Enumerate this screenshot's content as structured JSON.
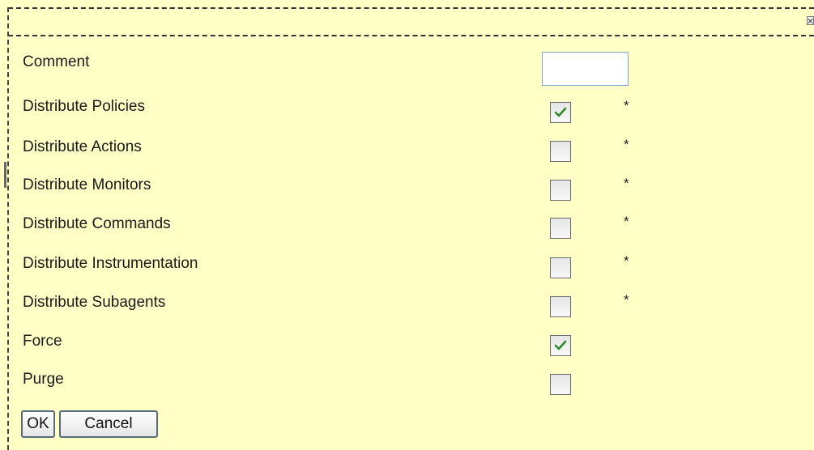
{
  "dialog": {
    "close_icon": "close-icon"
  },
  "fields": [
    {
      "label": "Comment",
      "type": "text",
      "value": ""
    },
    {
      "label": "Distribute Policies",
      "type": "checkbox",
      "checked": true,
      "asterisk": "*"
    },
    {
      "label": "Distribute Actions",
      "type": "checkbox",
      "checked": false,
      "asterisk": "*"
    },
    {
      "label": "Distribute Monitors",
      "type": "checkbox",
      "checked": false,
      "asterisk": "*"
    },
    {
      "label": "Distribute Commands",
      "type": "checkbox",
      "checked": false,
      "asterisk": "*"
    },
    {
      "label": "Distribute Instrumentation",
      "type": "checkbox",
      "checked": false,
      "asterisk": "*"
    },
    {
      "label": "Distribute Subagents",
      "type": "checkbox",
      "checked": false,
      "asterisk": "*"
    },
    {
      "label": "Force",
      "type": "checkbox",
      "checked": true
    },
    {
      "label": "Purge",
      "type": "checkbox",
      "checked": false
    }
  ],
  "buttons": {
    "ok_label": "OK",
    "cancel_label": "Cancel"
  },
  "colors": {
    "background": "#ffffc6",
    "check_mark": "#2e8b2e",
    "input_border": "#7ea2cc"
  }
}
